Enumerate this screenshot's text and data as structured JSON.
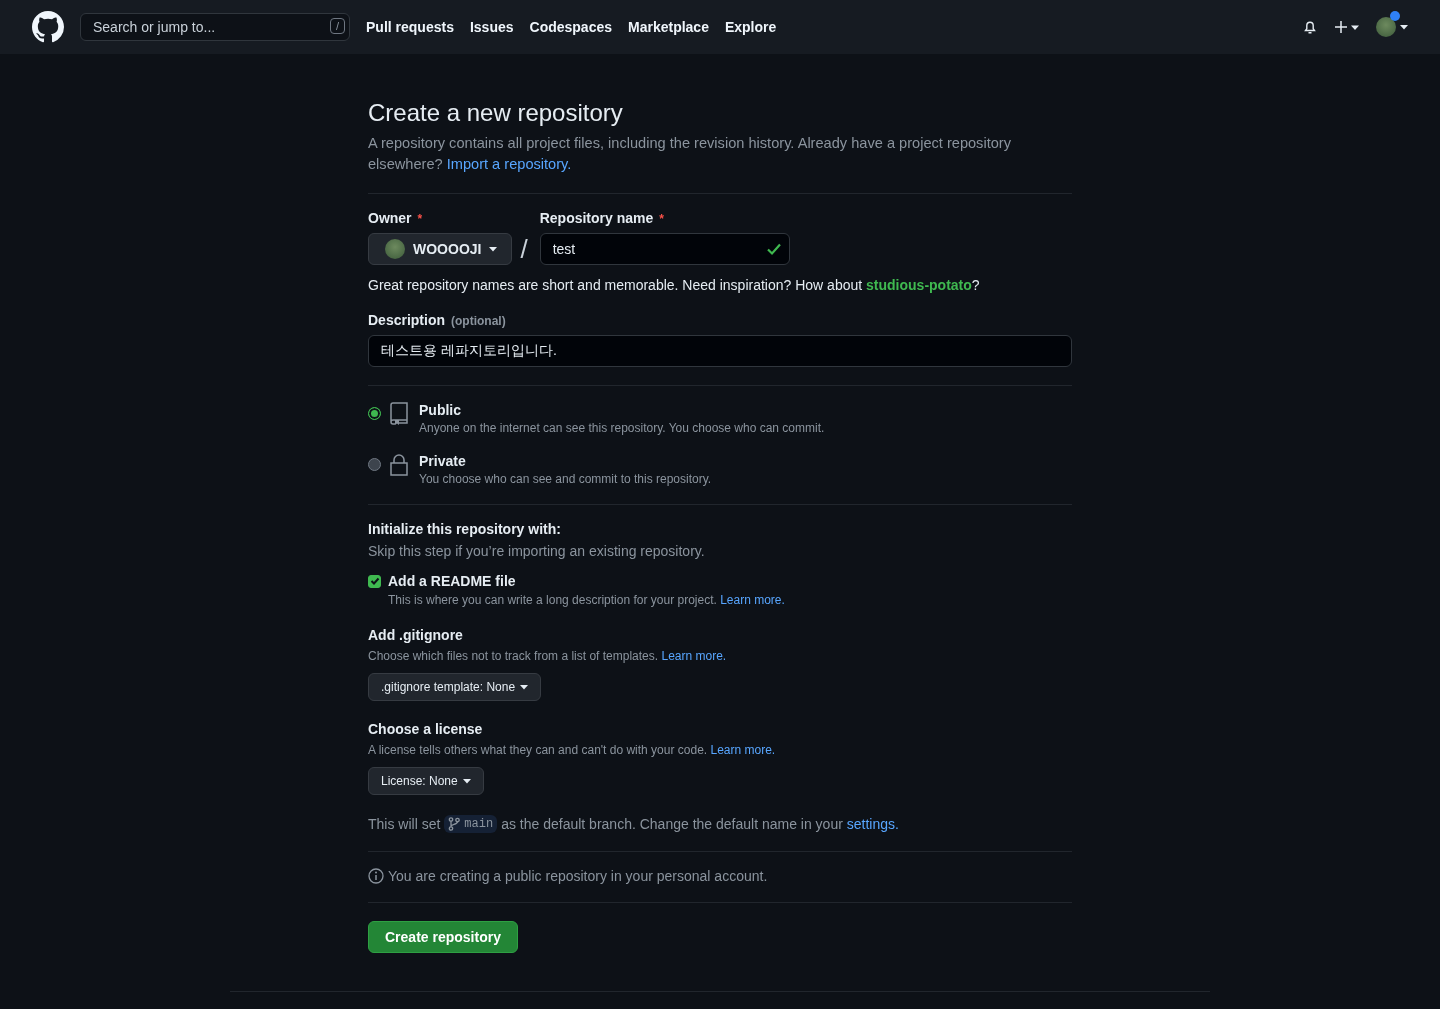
{
  "header": {
    "search": {
      "placeholder": "Search or jump to...",
      "shortcut": "/"
    },
    "nav": [
      "Pull requests",
      "Issues",
      "Codespaces",
      "Marketplace",
      "Explore"
    ]
  },
  "title": "Create a new repository",
  "intro": {
    "text": "A repository contains all project files, including the revision history. Already have a project repository elsewhere? ",
    "link": "Import a repository."
  },
  "owner": {
    "label": "Owner",
    "required": "*",
    "value": "WOOOOJI"
  },
  "separator": "/",
  "repo_name": {
    "label": "Repository name",
    "required": "*",
    "value": "test",
    "valid": true
  },
  "suggestion": {
    "text": "Great repository names are short and memorable. Need inspiration? How about ",
    "name": "studious-potato",
    "after": "?"
  },
  "description": {
    "label": "Description",
    "hint": "(optional)",
    "value": "테스트용 레파지토리입니다."
  },
  "visibility": [
    {
      "kind": "repo",
      "label": "Public",
      "description": "Anyone on the internet can see this repository. You choose who can commit.",
      "selected": true
    },
    {
      "kind": "lock",
      "label": "Private",
      "description": "You choose who can see and commit to this repository.",
      "selected": false
    }
  ],
  "init": {
    "heading": "Initialize this repository with:",
    "subtext": "Skip this step if you’re importing an existing repository."
  },
  "readme": {
    "label": "Add a README file",
    "checked": true,
    "description": "This is where you can write a long description for your project. ",
    "link": "Learn more."
  },
  "gitignore": {
    "heading": "Add .gitignore",
    "description": "Choose which files not to track from a list of templates. ",
    "link": "Learn more.",
    "dropdown": ".gitignore template: None"
  },
  "license": {
    "heading": "Choose a license",
    "description": "A license tells others what they can and can't do with your code. ",
    "link": "Learn more.",
    "dropdown": "License: None"
  },
  "branch": {
    "before": "This will set",
    "name": "main",
    "after": "as the default branch. Change the default name in your ",
    "link": "settings."
  },
  "info": "You are creating a public repository in your personal account.",
  "submit": "Create repository"
}
